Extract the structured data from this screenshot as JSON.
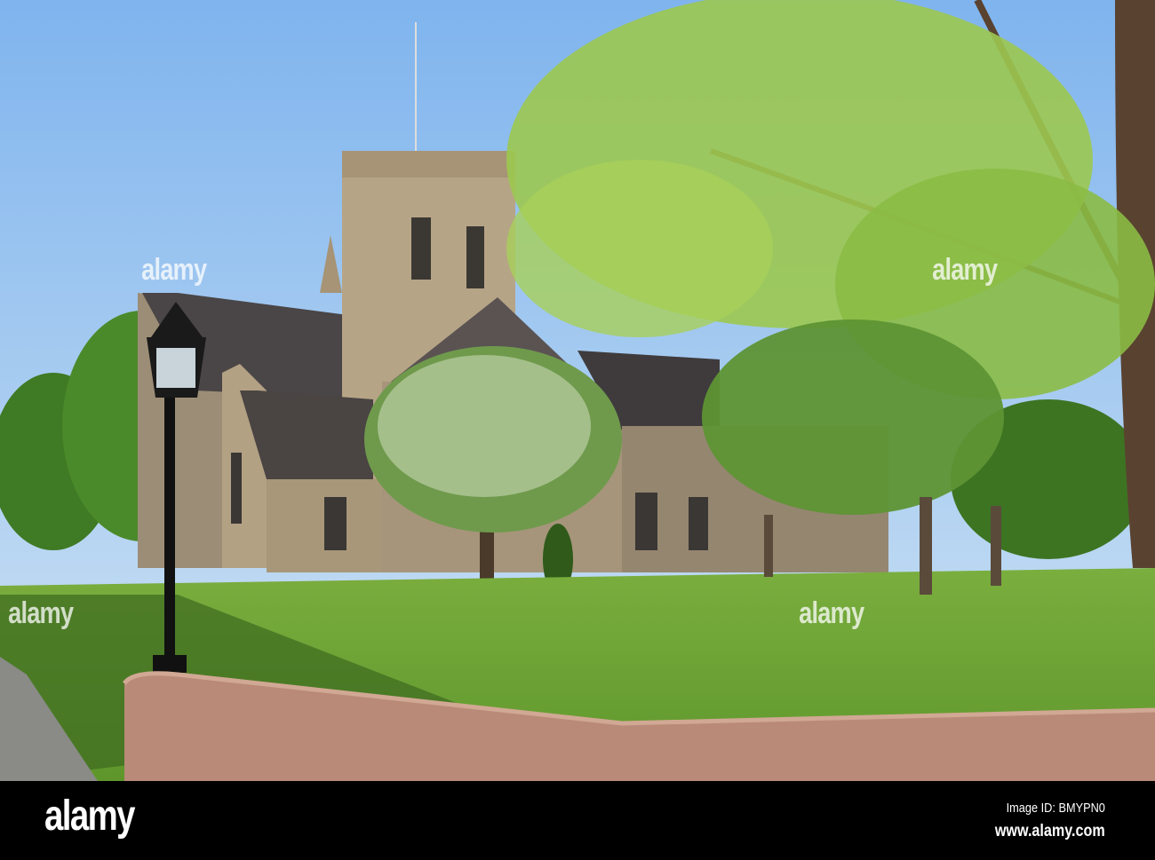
{
  "watermark": {
    "text": "alamy"
  },
  "footer": {
    "logo": "alamy",
    "image_id": "Image ID: BMYPN0",
    "url": "www.alamy.com"
  },
  "colors": {
    "sky": "#8cbff0",
    "grass": "#78b03a",
    "stone": "#b8a58a",
    "wall": "#b98a78"
  }
}
